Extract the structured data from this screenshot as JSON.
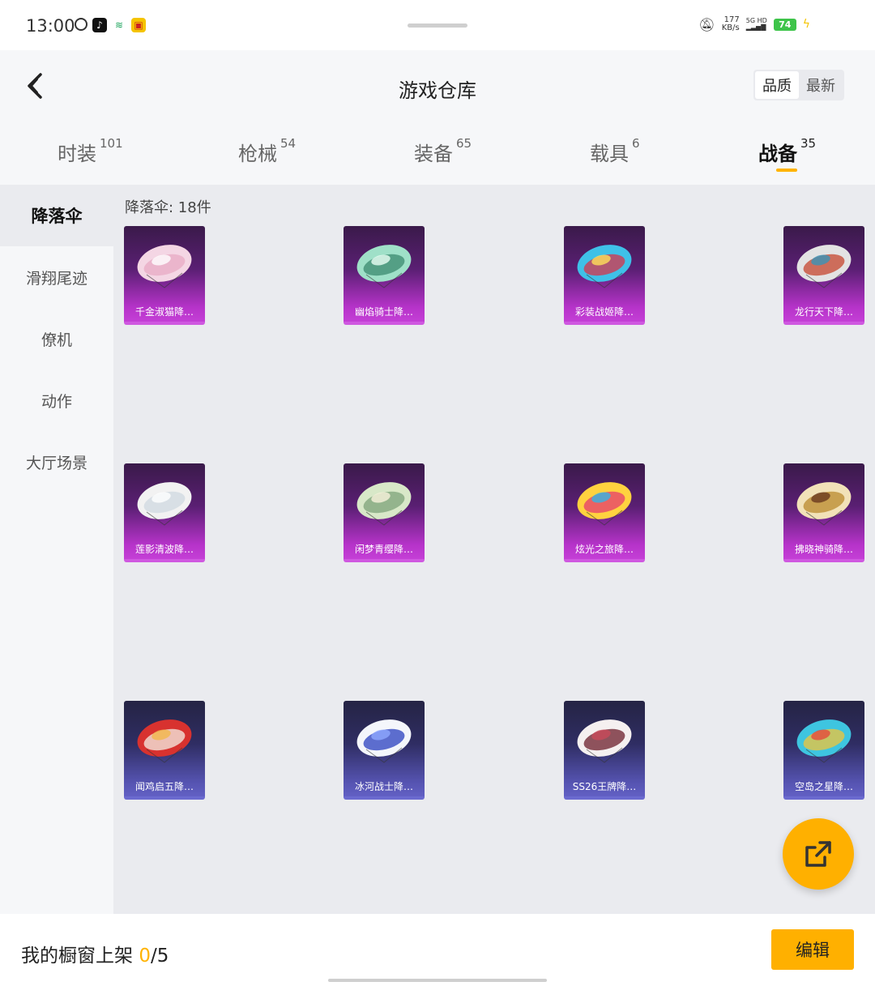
{
  "status": {
    "time": "13:00",
    "net_speed_value": "177",
    "net_speed_unit": "KB/s",
    "signal_label": "5G HD",
    "battery": "74"
  },
  "header": {
    "title": "游戏仓库",
    "sort_options": [
      "品质",
      "最新"
    ],
    "active_sort": "品质"
  },
  "tabs": [
    {
      "label": "时装",
      "count": "101"
    },
    {
      "label": "枪械",
      "count": "54"
    },
    {
      "label": "装备",
      "count": "65"
    },
    {
      "label": "载具",
      "count": "6"
    },
    {
      "label": "战备",
      "count": "35"
    }
  ],
  "active_tab": "战备",
  "sidebar": {
    "items": [
      "降落伞",
      "滑翔尾迹",
      "僚机",
      "动作",
      "大厅场景"
    ],
    "active": "降落伞"
  },
  "content": {
    "count_label": "降落伞: 18件",
    "items": [
      {
        "name": "千金淑猫降…",
        "rarity": "purple",
        "art": "cat"
      },
      {
        "name": "幽焰骑士降…",
        "rarity": "purple",
        "art": "green"
      },
      {
        "name": "彩装战姬降…",
        "rarity": "purple",
        "art": "colorful"
      },
      {
        "name": "龙行天下降…",
        "rarity": "purple",
        "art": "dragon"
      },
      {
        "name": "莲影清波降…",
        "rarity": "purple",
        "art": "white"
      },
      {
        "name": "闲梦青缨降…",
        "rarity": "purple",
        "art": "jade"
      },
      {
        "name": "炫光之旅降…",
        "rarity": "purple",
        "art": "rainbow"
      },
      {
        "name": "拂晓神骑降…",
        "rarity": "purple",
        "art": "gold"
      },
      {
        "name": "闻鸡启五降…",
        "rarity": "blue",
        "art": "red"
      },
      {
        "name": "冰河战士降…",
        "rarity": "blue",
        "art": "bluewhite"
      },
      {
        "name": "SS26王牌降…",
        "rarity": "blue",
        "art": "ss26"
      },
      {
        "name": "空岛之星降…",
        "rarity": "blue",
        "art": "island"
      }
    ]
  },
  "bottom": {
    "label_prefix": "我的橱窗上架",
    "current": "0",
    "separator": "/",
    "max": "5",
    "edit_label": "编辑"
  },
  "colors": {
    "accent": "#ffb000",
    "purple_rarity": "#c43fd6",
    "blue_rarity": "#6260c4"
  }
}
